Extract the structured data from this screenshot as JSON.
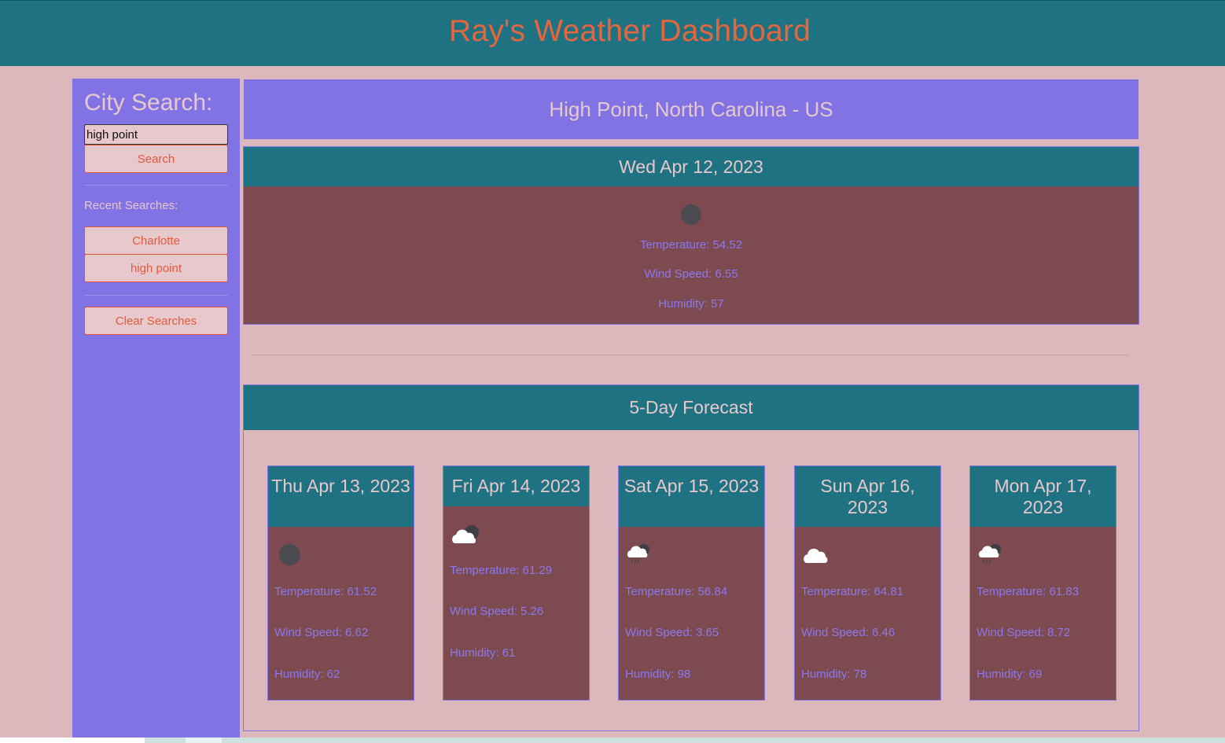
{
  "header": {
    "title": "Ray's Weather Dashboard"
  },
  "sidebar": {
    "title": "City Search:",
    "search_value": "high point",
    "search_button": "Search",
    "recent_label": "Recent Searches:",
    "recent": [
      "Charlotte",
      "high point"
    ],
    "clear_button": "Clear Searches"
  },
  "city": {
    "name": "High Point, North Carolina - US"
  },
  "current": {
    "date": "Wed Apr 12, 2023",
    "icon": "moon-icon",
    "temperature": "Temperature: 54.52",
    "wind": "Wind Speed: 6.55",
    "humidity": "Humidity: 57"
  },
  "forecast": {
    "title": "5-Day Forecast",
    "days": [
      {
        "date": "Thu Apr 13, 2023",
        "icon": "moon-icon",
        "temperature": "Temperature: 61.52",
        "wind": "Wind Speed: 6.62",
        "humidity": "Humidity: 62"
      },
      {
        "date": "Fri Apr 14, 2023",
        "icon": "cloudy-night-icon",
        "temperature": "Temperature: 61.29",
        "wind": "Wind Speed: 5.26",
        "humidity": "Humidity: 61"
      },
      {
        "date": "Sat Apr 15, 2023",
        "icon": "rain-night-icon",
        "temperature": "Temperature: 56.84",
        "wind": "Wind Speed: 3.65",
        "humidity": "Humidity: 98"
      },
      {
        "date": "Sun Apr 16, 2023",
        "icon": "cloud-icon",
        "temperature": "Temperature: 64.81",
        "wind": "Wind Speed: 6.46",
        "humidity": "Humidity: 78"
      },
      {
        "date": "Mon Apr 17, 2023",
        "icon": "rain-night-icon",
        "temperature": "Temperature: 61.83",
        "wind": "Wind Speed: 8.72",
        "humidity": "Humidity: 69"
      }
    ]
  },
  "colors": {
    "header_bg": "#1e7281",
    "title_color": "#e5663c",
    "sidebar_bg": "#8273e5",
    "card_bg": "#7d4b4f",
    "page_bg": "#dcb8bc"
  }
}
